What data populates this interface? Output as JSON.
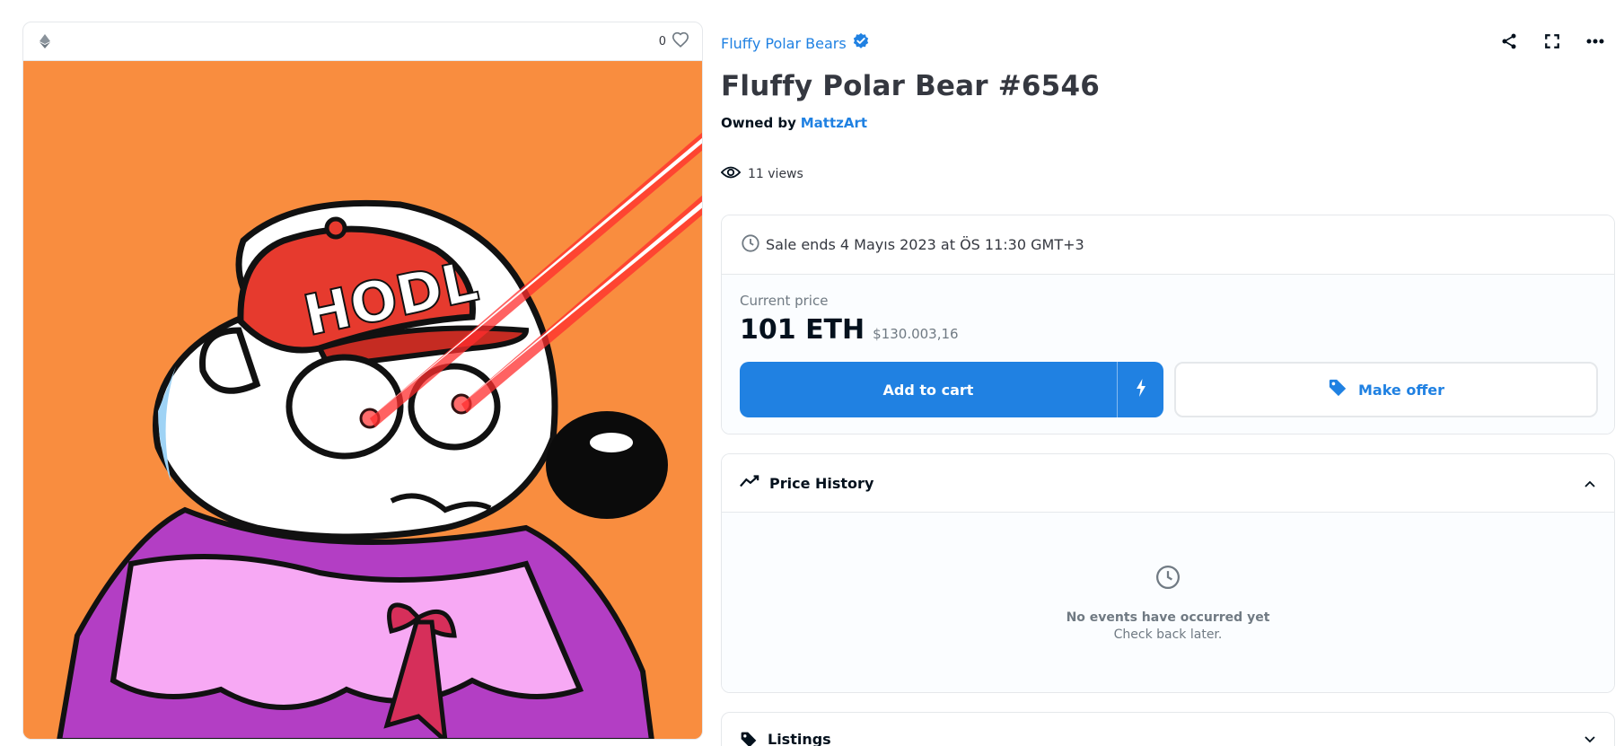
{
  "media": {
    "favorite_count": "0",
    "artwork_cap_text": "HODL"
  },
  "item": {
    "collection_name": "Fluffy Polar Bears",
    "title": "Fluffy Polar Bear #6546",
    "owned_by_label": "Owned by",
    "owner_name": "MattzArt",
    "views": "11 views"
  },
  "sale": {
    "ends_text": "Sale ends 4 Mayıs 2023 at ÖS 11:30 GMT+3",
    "current_price_label": "Current price",
    "price_eth": "101 ETH",
    "price_fiat": "$130.003,16",
    "add_to_cart_label": "Add to cart",
    "make_offer_label": "Make offer"
  },
  "price_history": {
    "title": "Price History",
    "empty_title": "No events have occurred yet",
    "empty_subtitle": "Check back later."
  },
  "listings": {
    "title": "Listings"
  },
  "colors": {
    "accent": "#2081e2",
    "artwork_bg": "#f98d3f",
    "text_dark": "#04111d",
    "muted": "#707a83",
    "border": "#e5e8eb"
  },
  "icons": {
    "eth": "ethereum-icon",
    "favorite": "heart-icon",
    "verified": "verified-badge-icon",
    "share": "share-icon",
    "fullscreen": "fullscreen-icon",
    "more": "more-icon",
    "views": "eye-icon",
    "clock": "clock-icon",
    "lightning": "lightning-icon",
    "tag": "tag-icon",
    "trend": "trending-icon",
    "chevron_up": "chevron-up-icon",
    "chevron_down": "chevron-down-icon"
  }
}
